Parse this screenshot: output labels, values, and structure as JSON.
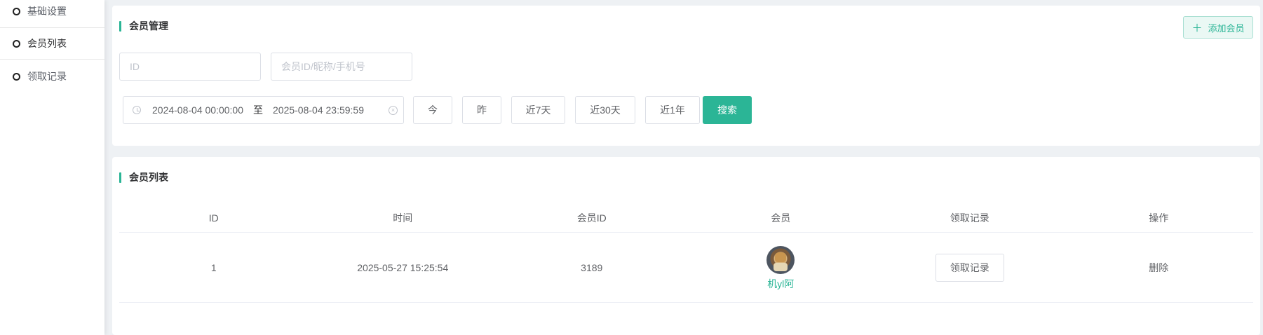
{
  "sidebar": {
    "items": [
      {
        "label": "基础设置"
      },
      {
        "label": "会员列表"
      },
      {
        "label": "领取记录"
      }
    ]
  },
  "filter_card": {
    "title": "会员管理",
    "add_button": "添加会员",
    "id_placeholder": "ID",
    "member_placeholder": "会员ID/昵称/手机号",
    "date_start": "2024-08-04 00:00:00",
    "date_separator": "至",
    "date_end": "2025-08-04 23:59:59",
    "quick_ranges": [
      "今",
      "昨",
      "近7天",
      "近30天",
      "近1年"
    ],
    "search_button": "搜索"
  },
  "list_card": {
    "title": "会员列表",
    "columns": [
      "ID",
      "时间",
      "会员ID",
      "会员",
      "领取记录",
      "操作"
    ],
    "rows": [
      {
        "id": "1",
        "time": "2025-05-27 15:25:54",
        "member_id": "3189",
        "member_name": "机yl阿",
        "record_button": "领取记录",
        "action": "删除"
      }
    ]
  },
  "colors": {
    "accent": "#2bb596",
    "background": "#eef1f4"
  }
}
